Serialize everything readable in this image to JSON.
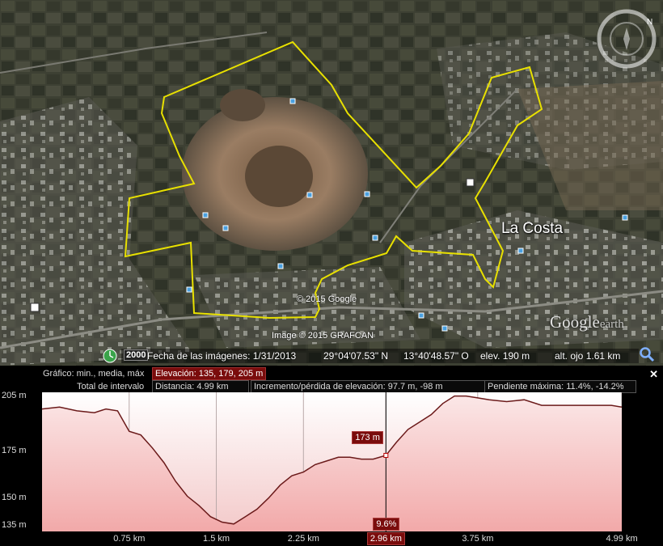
{
  "map": {
    "place_label": "La Costa",
    "attribution_google": "© 2015 Google",
    "attribution_imagery": "Image © 2015 GRAFCAN",
    "logo_main": "Google",
    "logo_sub": "earth",
    "compass_north": "N"
  },
  "status": {
    "historical_year": "2000",
    "imagery_date": "Fecha de las imágenes: 1/31/2013",
    "latitude": "29°04'07.53\" N",
    "longitude": "13°40'48.57\" O",
    "elevation": "elev.   190 m",
    "eye_alt": "alt. ojo   1.61 km"
  },
  "profile": {
    "graph_label": "Gráfico: min., media, máx",
    "elevation_stats": "Elevación: 135, 179, 205 m",
    "interval_label": "Total de intervalo",
    "distance": "Distancia: 4.99 km",
    "gain_loss": "Incremento/pérdida de elevación: 97.7 m, -98 m",
    "max_slope": "Pendiente máxima: 11.4%, -14.2%",
    "close": "✕",
    "cursor_elevation_label": "173 m",
    "cursor_slope_label": "9.6%",
    "cursor_distance_label": "2.96 km"
  },
  "chart_data": {
    "type": "area",
    "xlabel": "",
    "ylabel": "",
    "y_ticks": [
      "205 m",
      "175 m",
      "150 m",
      "135 m"
    ],
    "y_tick_values": [
      205,
      175,
      150,
      135
    ],
    "x_ticks": [
      "0.75 km",
      "1.5 km",
      "2.25 km",
      "2.96 km",
      "3.75 km",
      "4.99 km"
    ],
    "x_tick_values": [
      0.75,
      1.5,
      2.25,
      2.96,
      3.75,
      4.99
    ],
    "xlim": [
      0,
      4.99
    ],
    "ylim": [
      132,
      207
    ],
    "cursor": {
      "x": 2.96,
      "y": 173
    },
    "series": [
      {
        "x": [
          0,
          0.15,
          0.3,
          0.45,
          0.55,
          0.65,
          0.75,
          0.85,
          0.95,
          1.05,
          1.15,
          1.25,
          1.35,
          1.45,
          1.55,
          1.65,
          1.75,
          1.85,
          1.95,
          2.05,
          2.15,
          2.25,
          2.35,
          2.45,
          2.55,
          2.65,
          2.75,
          2.85,
          2.96,
          3.05,
          3.15,
          3.25,
          3.35,
          3.45,
          3.55,
          3.65,
          3.75,
          3.85,
          4.0,
          4.15,
          4.3,
          4.45,
          4.6,
          4.75,
          4.9,
          4.99
        ],
        "y": [
          198,
          199,
          197,
          196,
          198,
          197,
          186,
          184,
          177,
          169,
          159,
          151,
          146,
          140,
          137,
          136,
          140,
          144,
          150,
          157,
          162,
          164,
          168,
          170,
          172,
          172,
          171,
          171,
          173,
          180,
          187,
          191,
          195,
          201,
          205,
          205,
          204,
          203,
          202,
          203,
          200,
          200,
          200,
          200,
          200,
          199
        ]
      }
    ]
  }
}
